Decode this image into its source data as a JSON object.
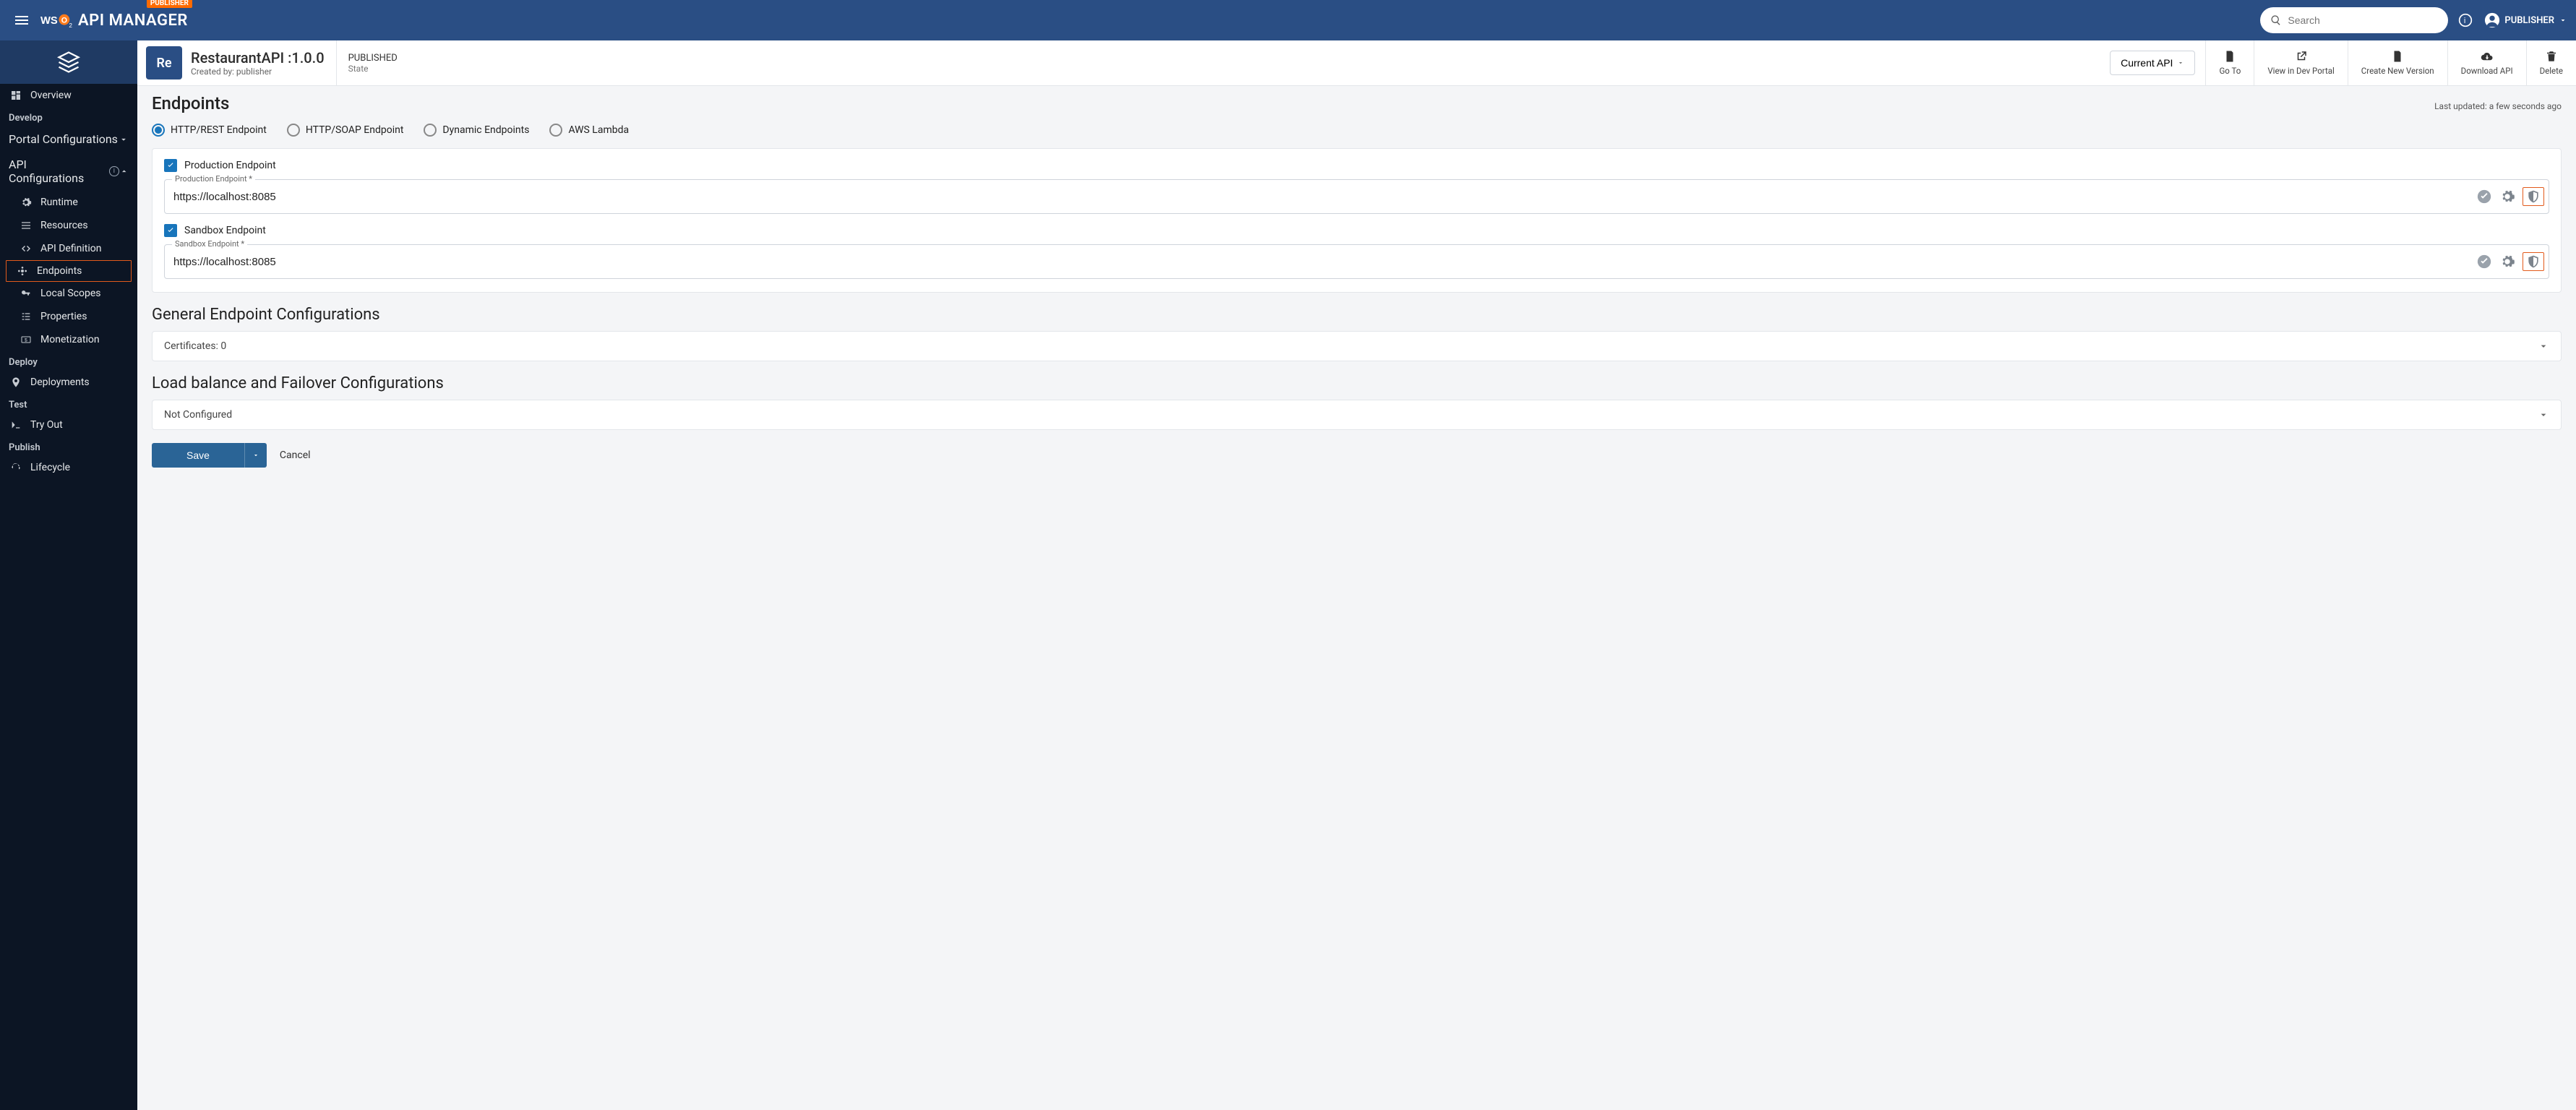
{
  "header": {
    "badge": "PUBLISHER",
    "product": "API MANAGER",
    "search_placeholder": "Search",
    "user": "PUBLISHER"
  },
  "sidebar": {
    "overview": "Overview",
    "develop": "Develop",
    "portal_conf": "Portal Configurations",
    "api_conf": "API Configurations",
    "items": {
      "runtime": "Runtime",
      "resources": "Resources",
      "api_def": "API Definition",
      "endpoints": "Endpoints",
      "local_scopes": "Local Scopes",
      "properties": "Properties",
      "monetization": "Monetization"
    },
    "deploy": "Deploy",
    "deployments": "Deployments",
    "test": "Test",
    "try_out": "Try Out",
    "publish": "Publish",
    "lifecycle": "Lifecycle"
  },
  "api": {
    "badge": "Re",
    "title": "RestaurantAPI :1.0.0",
    "created_by": "Created by: publisher",
    "state_value": "PUBLISHED",
    "state_label": "State",
    "current_api": "Current API",
    "actions": {
      "go_to": "Go To",
      "dev_portal": "View in Dev Portal",
      "new_version": "Create New Version",
      "download": "Download API",
      "delete": "Delete"
    }
  },
  "page": {
    "title": "Endpoints",
    "updated": "Last updated: a few seconds ago",
    "radios": {
      "http_rest": "HTTP/REST Endpoint",
      "http_soap": "HTTP/SOAP Endpoint",
      "dynamic": "Dynamic Endpoints",
      "aws": "AWS Lambda"
    },
    "endpoints": {
      "prod_check": "Production Endpoint",
      "prod_label": "Production Endpoint *",
      "prod_value": "https://localhost:8085",
      "sand_check": "Sandbox Endpoint",
      "sand_label": "Sandbox Endpoint *",
      "sand_value": "https://localhost:8085"
    },
    "general_title": "General Endpoint Configurations",
    "certificates": "Certificates: 0",
    "lb_title": "Load balance and Failover Configurations",
    "not_configured": "Not Configured",
    "save": "Save",
    "cancel": "Cancel"
  }
}
